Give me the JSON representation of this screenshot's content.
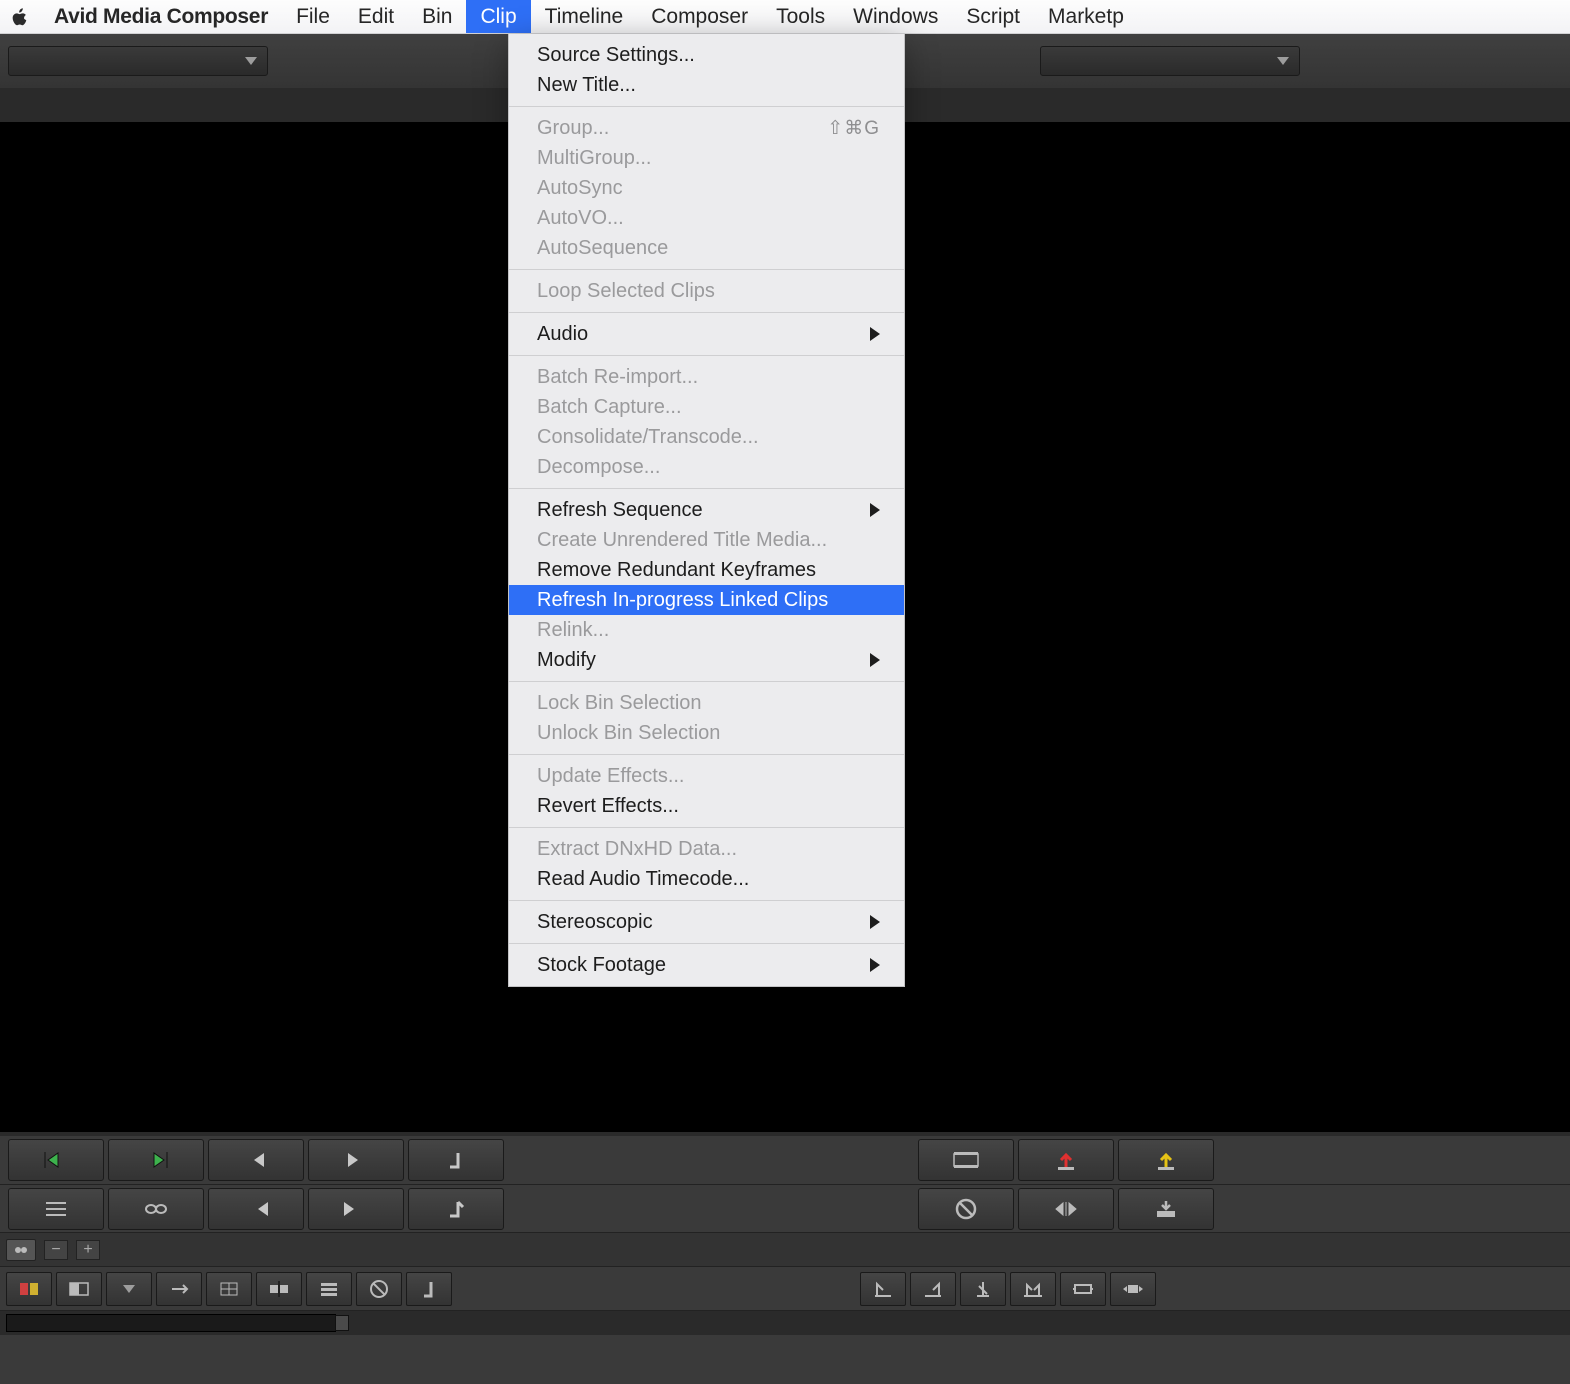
{
  "menubar": {
    "app_name": "Avid Media Composer",
    "items": [
      "File",
      "Edit",
      "Bin",
      "Clip",
      "Timeline",
      "Composer",
      "Tools",
      "Windows",
      "Script",
      "Marketp"
    ],
    "active_index": 3
  },
  "clip_menu": {
    "groups": [
      [
        {
          "label": "Source Settings...",
          "enabled": true
        },
        {
          "label": "New Title...",
          "enabled": true
        }
      ],
      [
        {
          "label": "Group...",
          "enabled": false,
          "shortcut": "⇧⌘G"
        },
        {
          "label": "MultiGroup...",
          "enabled": false
        },
        {
          "label": "AutoSync",
          "enabled": false
        },
        {
          "label": "AutoVO...",
          "enabled": false
        },
        {
          "label": "AutoSequence",
          "enabled": false
        }
      ],
      [
        {
          "label": "Loop Selected Clips",
          "enabled": false
        }
      ],
      [
        {
          "label": "Audio",
          "enabled": true,
          "submenu": true
        }
      ],
      [
        {
          "label": "Batch Re-import...",
          "enabled": false
        },
        {
          "label": "Batch Capture...",
          "enabled": false
        },
        {
          "label": "Consolidate/Transcode...",
          "enabled": false
        },
        {
          "label": "Decompose...",
          "enabled": false
        }
      ],
      [
        {
          "label": "Refresh Sequence",
          "enabled": true,
          "submenu": true
        },
        {
          "label": "Create Unrendered Title Media...",
          "enabled": false
        },
        {
          "label": "Remove Redundant Keyframes",
          "enabled": true
        },
        {
          "label": "Refresh In-progress Linked Clips",
          "enabled": true,
          "highlight": true
        },
        {
          "label": "Relink...",
          "enabled": false
        },
        {
          "label": "Modify",
          "enabled": true,
          "submenu": true
        }
      ],
      [
        {
          "label": "Lock Bin Selection",
          "enabled": false
        },
        {
          "label": "Unlock Bin Selection",
          "enabled": false
        }
      ],
      [
        {
          "label": "Update Effects...",
          "enabled": false
        },
        {
          "label": "Revert Effects...",
          "enabled": true
        }
      ],
      [
        {
          "label": "Extract DNxHD Data...",
          "enabled": false
        },
        {
          "label": "Read Audio Timecode...",
          "enabled": true
        }
      ],
      [
        {
          "label": "Stereoscopic",
          "enabled": true,
          "submenu": true
        }
      ],
      [
        {
          "label": "Stock Footage",
          "enabled": true,
          "submenu": true
        }
      ]
    ]
  },
  "transport": {
    "row_a": [
      "mark-in-prev",
      "mark-in-next",
      "step-back",
      "step-fwd",
      "mark-out",
      "",
      "",
      "",
      "",
      "film-strip",
      "lift-up",
      "extract-up",
      ""
    ],
    "row_b": [
      "list-view",
      "link-toggle",
      "frame-back",
      "frame-fwd",
      "mark-out-alt",
      "",
      "",
      "",
      "",
      "no-effect",
      "go-to-cut",
      "overwrite",
      ""
    ]
  },
  "timeline_toolbar": {
    "buttons": [
      "segment-mode",
      "overwrite-mode",
      "dropdown",
      "expand",
      "grid",
      "insert-seg",
      "stack",
      "no-entry",
      "mark-clip",
      "",
      "",
      "",
      "",
      "",
      "",
      "",
      "",
      "",
      "trim-a",
      "trim-b",
      "razor",
      "trim-roll",
      "slip",
      "slide"
    ]
  }
}
